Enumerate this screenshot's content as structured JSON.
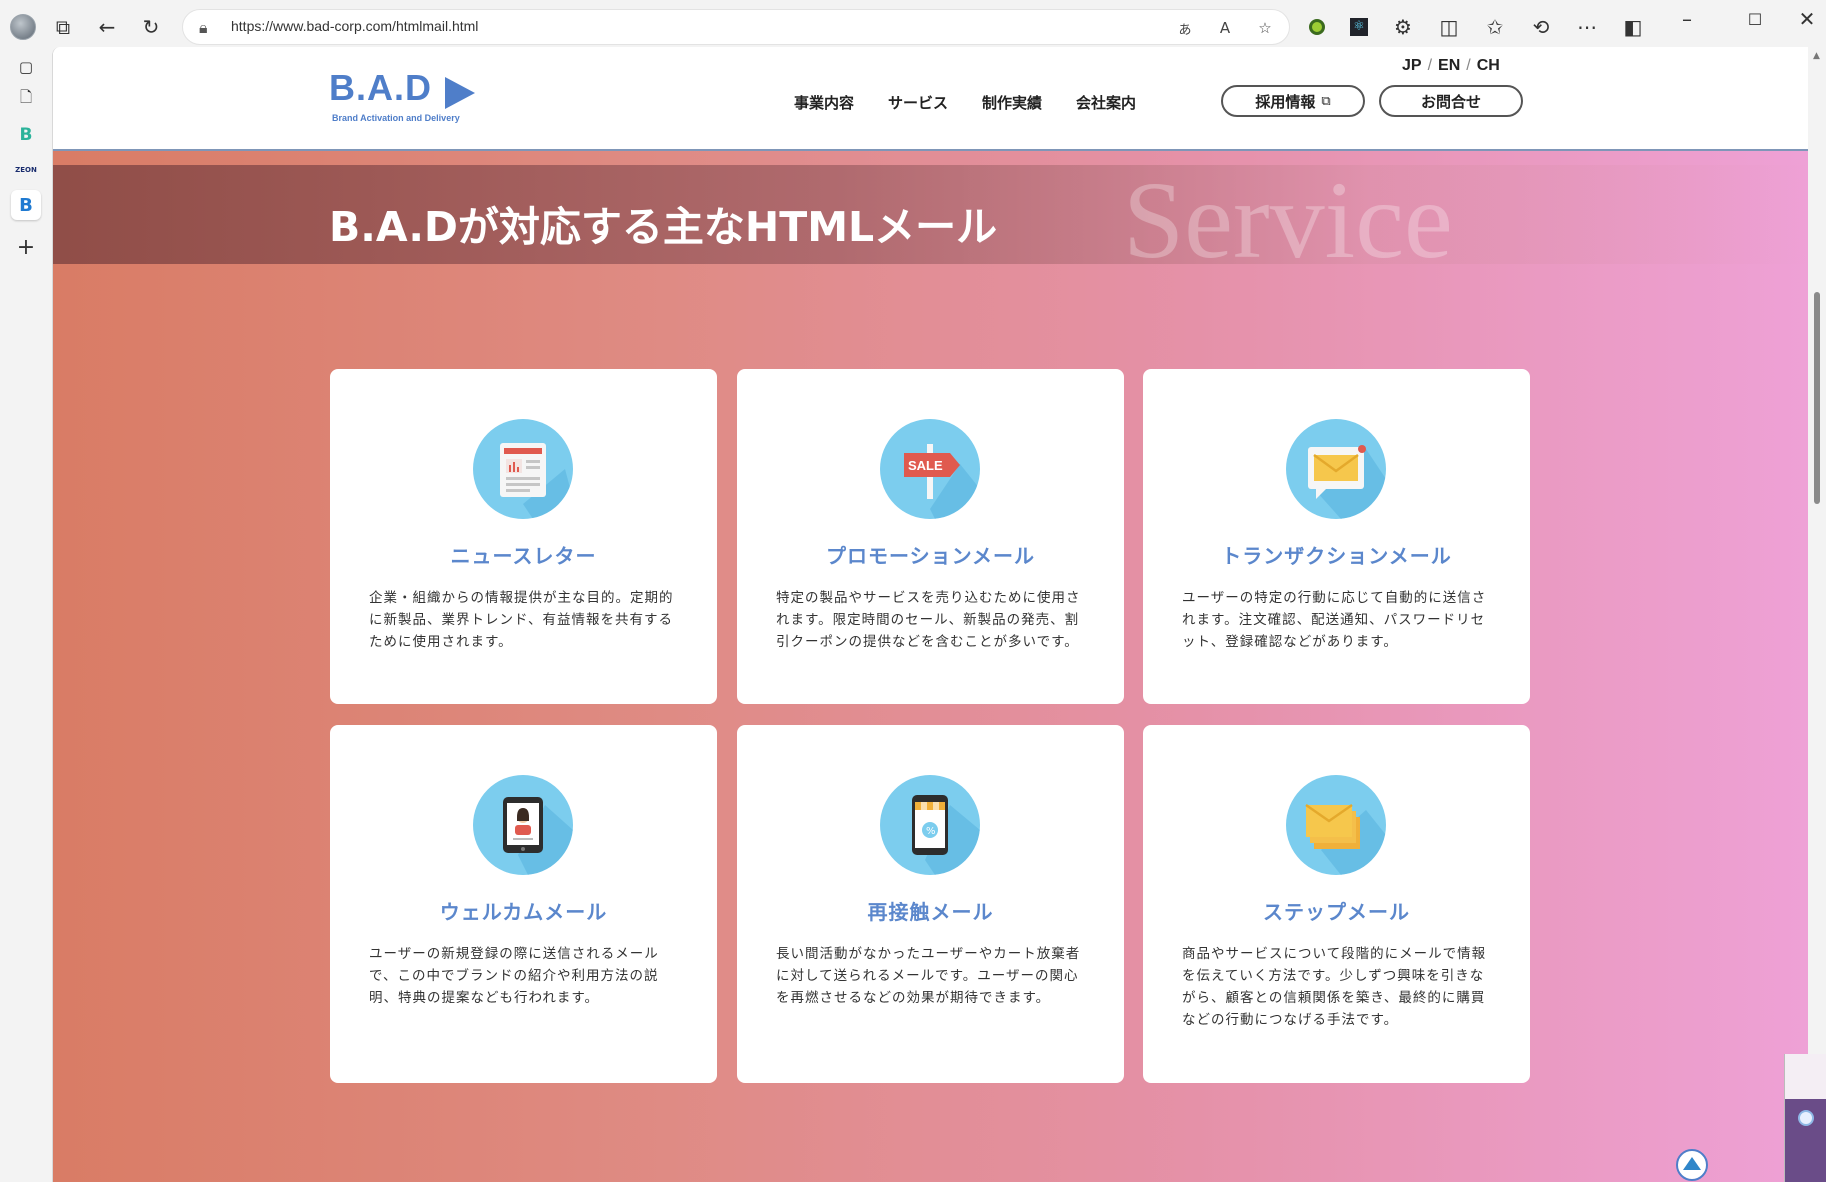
{
  "browser": {
    "url": "https://www.bad-corp.com/htmlmail.html",
    "icons": [
      "profile-avatar",
      "tabs-icon",
      "back-icon",
      "refresh-icon",
      "lock-icon",
      "read-aloud-icon",
      "favorite-star-icon",
      "extension-icon",
      "split-screen-icon",
      "favorites-icon",
      "history-icon",
      "more-icon",
      "sidebar-toggle-icon",
      "minimize-icon",
      "maximize-icon",
      "close-icon"
    ],
    "sidebar_items": [
      {
        "name": "tab-actions-icon",
        "glyph": "▢"
      },
      {
        "name": "page-icon",
        "glyph": "🗋"
      },
      {
        "name": "b-app-green",
        "glyph": "B",
        "color": "#2bb39a"
      },
      {
        "name": "zeon-app",
        "glyph": "ZEON",
        "color": "#1a2d6e"
      },
      {
        "name": "b-app-blue",
        "glyph": "B",
        "color": "#1f7ad1"
      },
      {
        "name": "add-icon",
        "glyph": "+"
      }
    ]
  },
  "site": {
    "logo": {
      "text": "B.A.D",
      "subtitle": "Brand Activation and Delivery"
    },
    "nav": [
      "事業内容",
      "サービス",
      "制作実績",
      "会社案内"
    ],
    "lang": [
      "JP",
      "EN",
      "CH"
    ],
    "buttons": {
      "recruit": "採用情報",
      "contact": "お問合せ"
    },
    "colors": {
      "brand": "#4f7ec9",
      "card_title": "#5b87cc",
      "icon_circle": "#7ccdee"
    }
  },
  "section": {
    "title": "B.A.Dが対応する主なHTMLメール",
    "bg_word": "Service"
  },
  "cards": [
    {
      "icon": "newsletter-icon",
      "title": "ニュースレター",
      "desc": "企業・組織からの情報提供が主な目的。定期的に新製品、業界トレンド、有益情報を共有するために使用されます。"
    },
    {
      "icon": "sale-sign-icon",
      "title": "プロモーションメール",
      "desc": "特定の製品やサービスを売り込むために使用されます。限定時間のセール、新製品の発売、割引クーポンの提供などを含むことが多いです。",
      "icon_label": "SALE"
    },
    {
      "icon": "envelope-notification-icon",
      "title": "トランザクションメール",
      "desc": "ユーザーの特定の行動に応じて自動的に送信されます。注文確認、配送通知、パスワードリセット、登録確認などがあります。"
    },
    {
      "icon": "tablet-profile-icon",
      "title": "ウェルカムメール",
      "desc": "ユーザーの新規登録の際に送信されるメールで、この中でブランドの紹介や利用方法の説明、特典の提案なども行われます。"
    },
    {
      "icon": "mobile-shop-icon",
      "title": "再接触メール",
      "desc": "長い間活動がなかったユーザーやカート放棄者に対して送られるメールです。ユーザーの関心を再燃させるなどの効果が期待できます。"
    },
    {
      "icon": "stacked-envelopes-icon",
      "title": "ステップメール",
      "desc": "商品やサービスについて段階的にメールで情報を伝えていく方法です。少しずつ興味を引きながら、顧客との信頼関係を築き、最終的に購買などの行動につなげる手法です。"
    }
  ]
}
